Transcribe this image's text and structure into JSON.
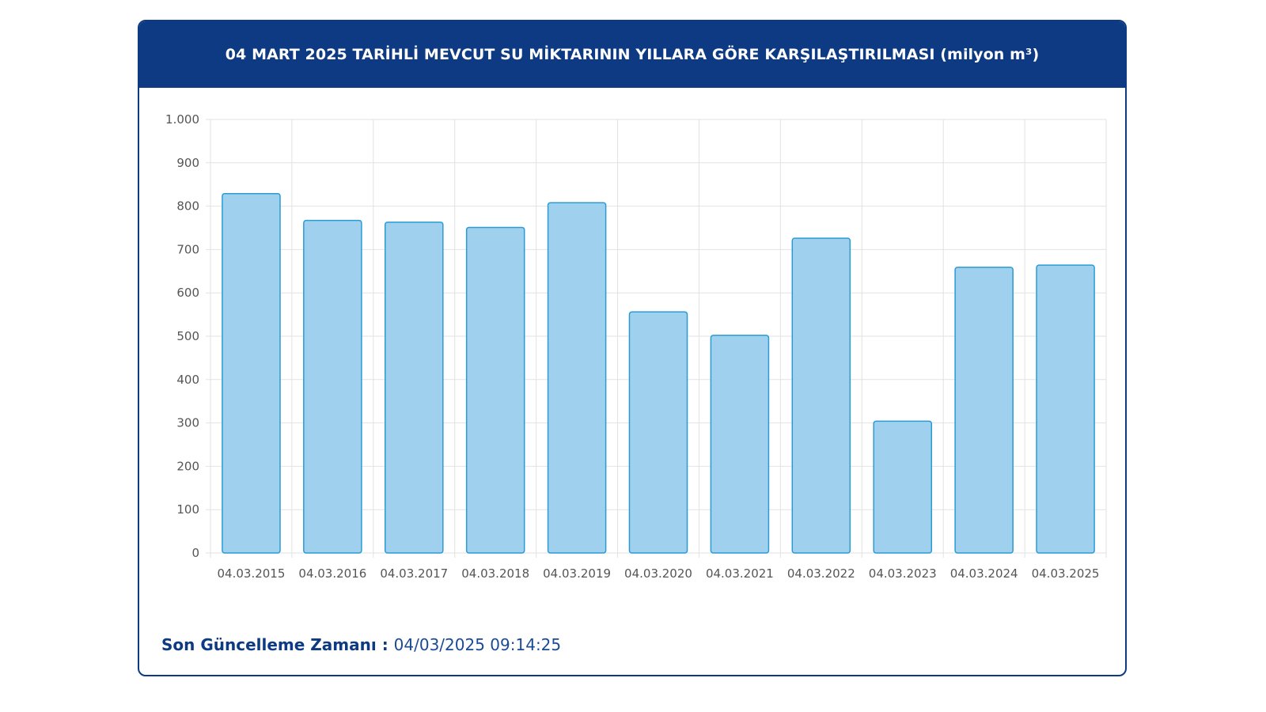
{
  "header": {
    "title": "04 MART 2025 TARİHLİ MEVCUT SU MİKTARININ YILLARA GÖRE KARŞILAŞTIRILMASI (milyon m³)"
  },
  "footer": {
    "label": "Son Güncelleme Zamanı",
    "separator": " : ",
    "value": "04/03/2025 09:14:25"
  },
  "colors": {
    "header_bg": "#0d3a82",
    "bar_fill": "#9fd0ee",
    "bar_stroke": "#2b9bd2",
    "grid": "#e2e2e2",
    "tick_text": "#555555"
  },
  "chart_data": {
    "type": "bar",
    "categories": [
      "04.03.2015",
      "04.03.2016",
      "04.03.2017",
      "04.03.2018",
      "04.03.2019",
      "04.03.2020",
      "04.03.2021",
      "04.03.2022",
      "04.03.2023",
      "04.03.2024",
      "04.03.2025"
    ],
    "values": [
      829,
      767,
      763,
      751,
      808,
      556,
      502,
      726,
      304,
      659,
      664
    ],
    "ylim": [
      0,
      1000
    ],
    "yticks": [
      0,
      100,
      200,
      300,
      400,
      500,
      600,
      700,
      800,
      900,
      1000
    ],
    "ytick_labels": [
      "0",
      "100",
      "200",
      "300",
      "400",
      "500",
      "600",
      "700",
      "800",
      "900",
      "1.000"
    ],
    "grid": true,
    "legend": "none"
  }
}
